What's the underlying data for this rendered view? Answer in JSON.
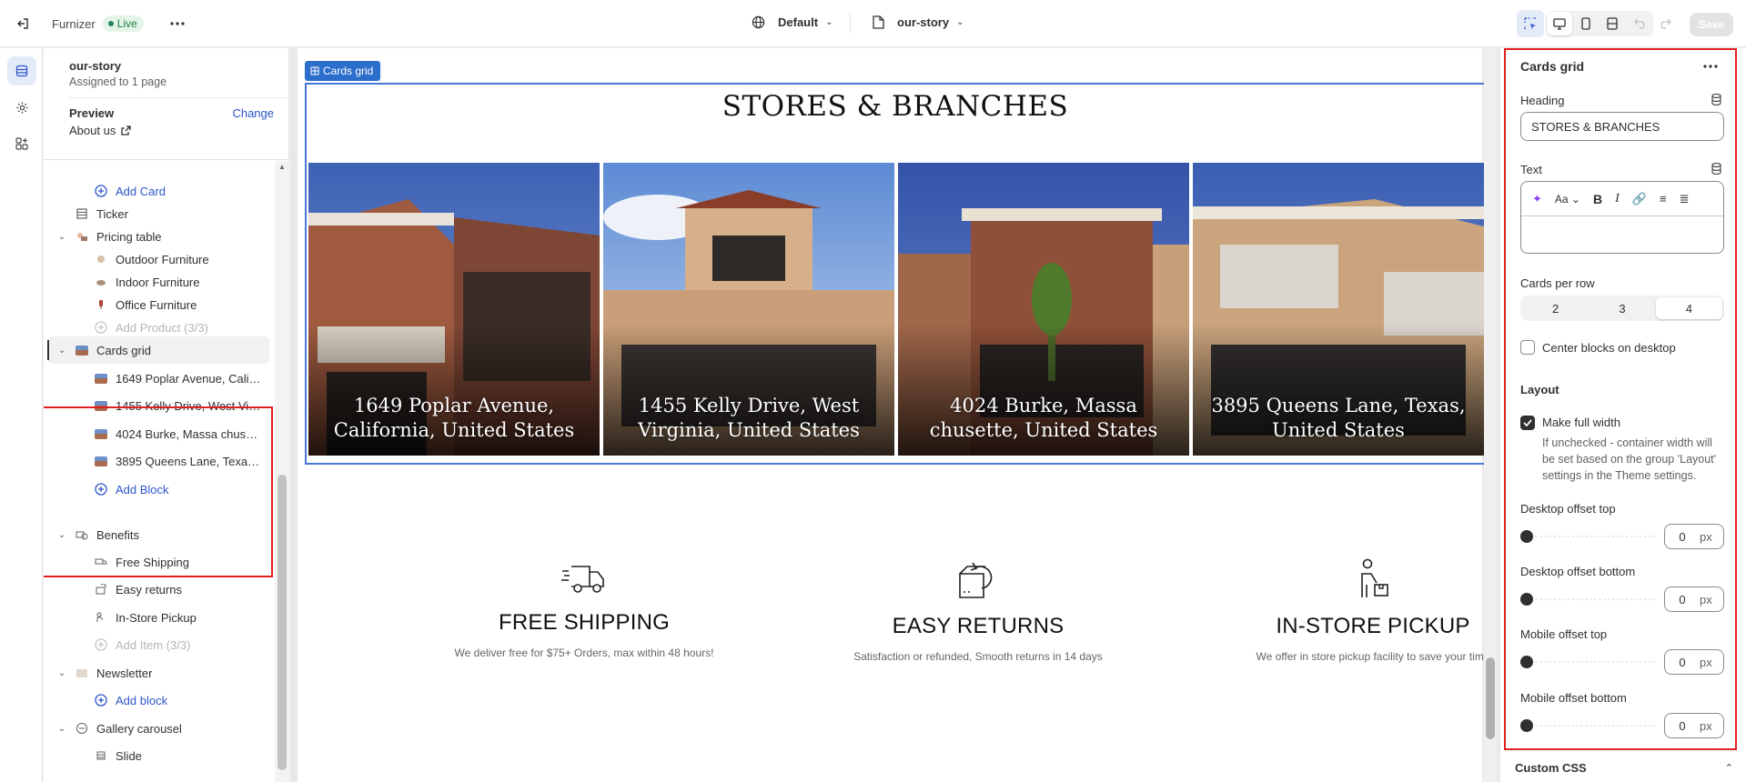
{
  "topbar": {
    "store_name": "Furnizer",
    "status": "Live",
    "theme_selector": "Default",
    "page_selector": "our-story",
    "save_label": "Save"
  },
  "sidebar": {
    "page_name": "our-story",
    "assigned": "Assigned to 1 page",
    "preview_label": "Preview",
    "change_label": "Change",
    "preview_page": "About us",
    "tree": {
      "add_card": "Add Card",
      "ticker": "Ticker",
      "pricing_table": "Pricing table",
      "outdoor": "Outdoor Furniture",
      "indoor": "Indoor Furniture",
      "office": "Office Furniture",
      "add_product": "Add Product (3/3)",
      "cards_grid": "Cards grid",
      "card1": "1649 Poplar Avenue, Califo...",
      "card2": "1455 Kelly Drive, West Virg...",
      "card3": "4024 Burke, Massa chuset...",
      "card4": "3895 Queens Lane, Texas, ...",
      "add_block": "Add Block",
      "benefits": "Benefits",
      "free_shipping": "Free Shipping",
      "easy_returns": "Easy returns",
      "instore": "In-Store Pickup",
      "add_item": "Add Item (3/3)",
      "newsletter": "Newsletter",
      "add_block2": "Add block",
      "gallery": "Gallery carousel",
      "slide": "Slide"
    }
  },
  "canvas": {
    "selected_tag": "Cards grid",
    "heading": "STORES & BRANCHES",
    "cards": [
      "1649 Poplar Avenue, California, United States",
      "1455 Kelly Drive, West Virginia, United States",
      "4024 Burke, Massa chusette, United States",
      "3895 Queens Lane, Texas, United States"
    ],
    "benefits": [
      {
        "title": "FREE SHIPPING",
        "text": "We deliver free for $75+ Orders, max within 48 hours!"
      },
      {
        "title": "EASY RETURNS",
        "text": "Satisfaction or refunded, Smooth returns in 14 days"
      },
      {
        "title": "IN-STORE PICKUP",
        "text": "We offer in store pickup facility to save your time"
      }
    ]
  },
  "props": {
    "title": "Cards grid",
    "heading_label": "Heading",
    "heading_value": "STORES & BRANCHES",
    "text_label": "Text",
    "cards_per_row_label": "Cards per row",
    "cards_per_row_options": [
      "2",
      "3",
      "4"
    ],
    "cards_per_row_selected": "4",
    "center_label": "Center blocks on desktop",
    "layout_label": "Layout",
    "full_width_label": "Make full width",
    "full_width_help": "If unchecked - container width will be set based on the group 'Layout' settings in the Theme settings.",
    "desk_top_label": "Desktop offset top",
    "desk_bottom_label": "Desktop offset bottom",
    "mob_top_label": "Mobile offset top",
    "mob_bottom_label": "Mobile offset bottom",
    "offset_value": "0",
    "unit": "px",
    "custom_css_label": "Custom CSS"
  }
}
